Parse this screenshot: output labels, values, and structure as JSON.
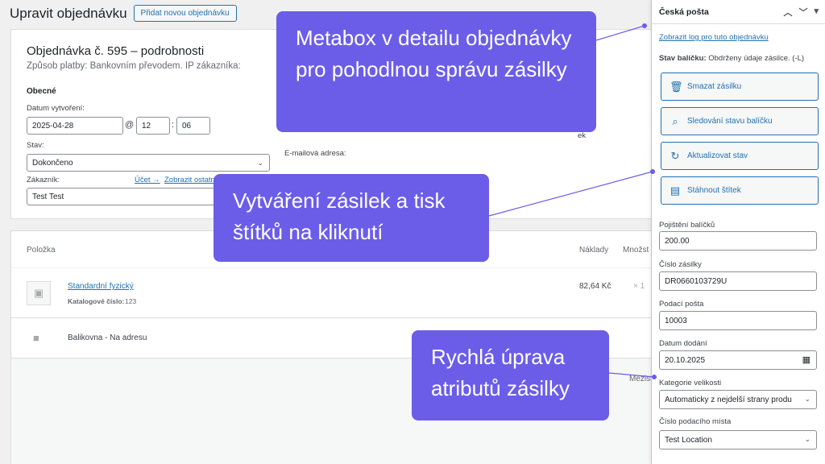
{
  "header": {
    "title": "Upravit objednávku",
    "add_button": "Přidat novou objednávku"
  },
  "order": {
    "heading": "Objednávka č. 595 – podrobnosti",
    "payment_info": "Způsob platby: Bankovním převodem. IP zákazníka:",
    "general_title": "Obecné",
    "created_label": "Datum vytvoření:",
    "created_date": "2025-04-28",
    "at_symbol": "@",
    "created_hour": "12",
    "time_sep": ":",
    "created_minute": "06",
    "status_label": "Stav:",
    "status_value": "Dokončeno",
    "customer_label": "Zákazník:",
    "account_link": "Účet →",
    "view_other_link": "Zobrazit ostatn",
    "customer_value": "Test Test",
    "email_label": "E-mailová adresa:",
    "partial_text": "ek"
  },
  "items": {
    "col_item": "Položka",
    "col_cost": "Náklady",
    "col_qty": "Množst",
    "product_name": "Standardní fyzický",
    "sku_label": "Katalogové číslo:",
    "sku_value": "123",
    "product_cost": "82,64 Kč",
    "product_qty": "× 1",
    "shipping_name": "Balikovna - Na adresu",
    "subtotal_partial": "Mezisi"
  },
  "sidebar": {
    "title": "Česká pošta",
    "log_link": "Zobrazit log pro tuto objednávku",
    "pkg_status_label": "Stav balíčku:",
    "pkg_status_value": "Obdrženy údaje zásilce. (-L)",
    "btn_delete": "Smazat zásilku",
    "btn_track": "Sledování stavu balíčku",
    "btn_update": "Aktualizovat stav",
    "btn_download": "Stáhnout štítek",
    "insurance_label": "Pojištění balíčků",
    "insurance_value": "200.00",
    "parcel_number_label": "Číslo zásilky",
    "parcel_number_value": "DR0660103729U",
    "post_office_label": "Podací pošta",
    "post_office_value": "10003",
    "delivery_date_label": "Datum dodání",
    "delivery_date_value": "20.10.2025",
    "size_category_label": "Kategorie velikosti",
    "size_category_value": "Automaticky z nejdelší strany produ",
    "location_label": "Číslo podacího místa",
    "location_value": "Test Location"
  },
  "callouts": {
    "metabox": "Metabox v detailu objednávky pro pohodlnou správu zásilky",
    "labels": "Vytváření zásilek a tisk štítků na kliknutí",
    "attributes": "Rychlá úprava atributů zásilky"
  },
  "colors": {
    "callout_bg": "#6b5de8",
    "link": "#2271b1"
  },
  "icons": [
    "trash-icon",
    "search-icon",
    "refresh-icon",
    "document-icon",
    "image-placeholder-icon",
    "truck-icon",
    "chevron-up-icon",
    "chevron-down-icon",
    "triangle-down-icon",
    "calendar-icon"
  ]
}
